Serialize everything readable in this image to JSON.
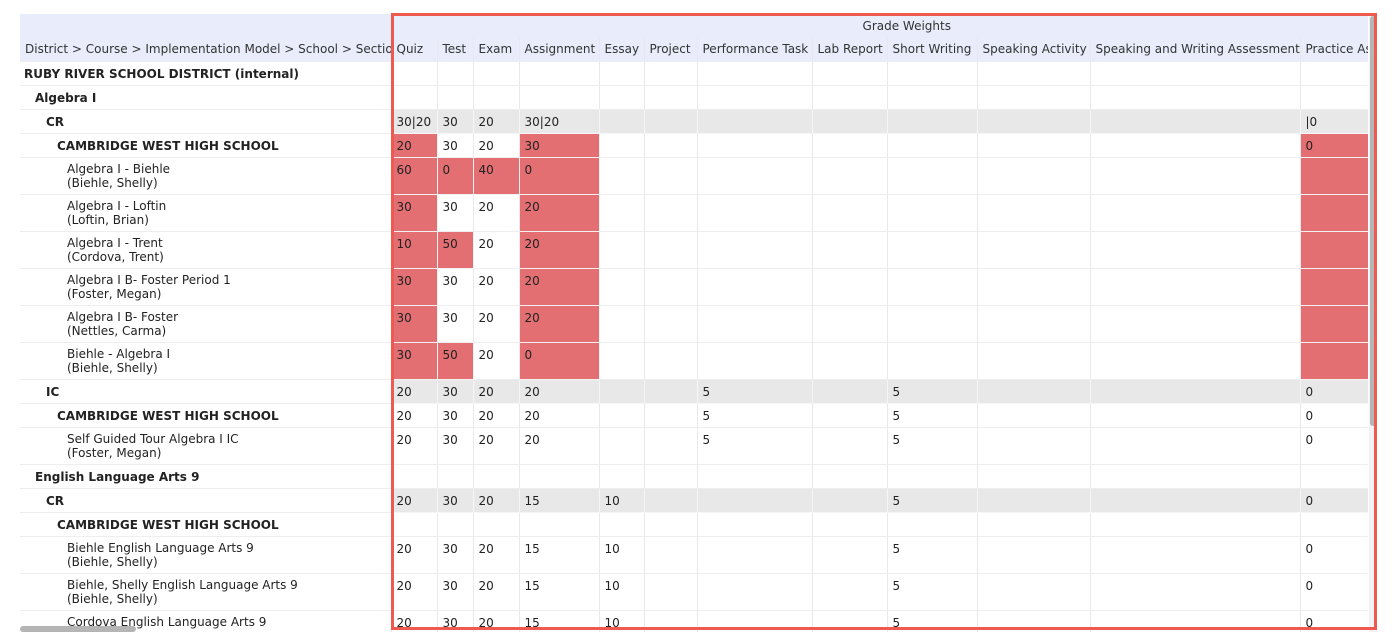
{
  "header": {
    "group_title": "Grade Weights",
    "tree_column": "District > Course > Implementation Model > School > Section",
    "columns": [
      "Quiz",
      "Test",
      "Exam",
      "Assignment",
      "Essay",
      "Project",
      "Performance Task",
      "Lab Report",
      "Short Writing",
      "Speaking Activity",
      "Speaking and Writing Assessment",
      "Practice Assessment"
    ]
  },
  "rows": [
    {
      "label": "RUBY RIVER SCHOOL DISTRICT (internal)",
      "weights": [
        "",
        "",
        "",
        "",
        "",
        "",
        "",
        "",
        "",
        "",
        "",
        ""
      ]
    },
    {
      "label": "Algebra I",
      "weights": [
        "",
        "",
        "",
        "",
        "",
        "",
        "",
        "",
        "",
        "",
        "",
        ""
      ]
    },
    {
      "label": "CR",
      "weights": [
        "30|20",
        "30",
        "20",
        "30|20",
        "",
        "",
        "",
        "",
        "",
        "",
        "",
        "|0"
      ]
    },
    {
      "label": "CAMBRIDGE WEST HIGH SCHOOL",
      "weights": [
        "20",
        "30",
        "20",
        "30",
        "",
        "",
        "",
        "",
        "",
        "",
        "",
        "0"
      ]
    },
    {
      "label": "Algebra I - Biehle",
      "teacher": "(Biehle, Shelly)",
      "weights": [
        "60",
        "0",
        "40",
        "0",
        "",
        "",
        "",
        "",
        "",
        "",
        "",
        ""
      ]
    },
    {
      "label": "Algebra I - Loftin",
      "teacher": "(Loftin, Brian)",
      "weights": [
        "30",
        "30",
        "20",
        "20",
        "",
        "",
        "",
        "",
        "",
        "",
        "",
        ""
      ]
    },
    {
      "label": "Algebra I - Trent",
      "teacher": "(Cordova, Trent)",
      "weights": [
        "10",
        "50",
        "20",
        "20",
        "",
        "",
        "",
        "",
        "",
        "",
        "",
        ""
      ]
    },
    {
      "label": "Algebra I B- Foster Period 1",
      "teacher": "(Foster, Megan)",
      "weights": [
        "30",
        "30",
        "20",
        "20",
        "",
        "",
        "",
        "",
        "",
        "",
        "",
        ""
      ]
    },
    {
      "label": "Algebra I B- Foster",
      "teacher": "(Nettles, Carma)",
      "weights": [
        "30",
        "30",
        "20",
        "20",
        "",
        "",
        "",
        "",
        "",
        "",
        "",
        ""
      ]
    },
    {
      "label": "Biehle - Algebra I",
      "teacher": "(Biehle, Shelly)",
      "weights": [
        "30",
        "50",
        "20",
        "0",
        "",
        "",
        "",
        "",
        "",
        "",
        "",
        ""
      ]
    },
    {
      "label": "IC",
      "weights": [
        "20",
        "30",
        "20",
        "20",
        "",
        "",
        "5",
        "",
        "5",
        "",
        "",
        "0"
      ]
    },
    {
      "label": "CAMBRIDGE WEST HIGH SCHOOL",
      "weights": [
        "20",
        "30",
        "20",
        "20",
        "",
        "",
        "5",
        "",
        "5",
        "",
        "",
        "0"
      ]
    },
    {
      "label": "Self Guided Tour Algebra I IC",
      "teacher": "(Foster, Megan)",
      "weights": [
        "20",
        "30",
        "20",
        "20",
        "",
        "",
        "5",
        "",
        "5",
        "",
        "",
        "0"
      ]
    },
    {
      "label": "English Language Arts 9",
      "weights": [
        "",
        "",
        "",
        "",
        "",
        "",
        "",
        "",
        "",
        "",
        "",
        ""
      ]
    },
    {
      "label": "CR",
      "weights": [
        "20",
        "30",
        "20",
        "15",
        "10",
        "",
        "",
        "",
        "5",
        "",
        "",
        "0"
      ]
    },
    {
      "label": "CAMBRIDGE WEST HIGH SCHOOL",
      "weights": [
        "",
        "",
        "",
        "",
        "",
        "",
        "",
        "",
        "",
        "",
        "",
        ""
      ]
    },
    {
      "label": "Biehle English Language Arts 9",
      "teacher": "(Biehle, Shelly)",
      "weights": [
        "20",
        "30",
        "20",
        "15",
        "10",
        "",
        "",
        "",
        "5",
        "",
        "",
        "0"
      ]
    },
    {
      "label": "Biehle, Shelly English Language Arts 9",
      "teacher": "(Biehle, Shelly)",
      "weights": [
        "20",
        "30",
        "20",
        "15",
        "10",
        "",
        "",
        "",
        "5",
        "",
        "",
        "0"
      ]
    },
    {
      "label": "Cordova English Language Arts 9",
      "teacher": "",
      "weights": [
        "20",
        "30",
        "20",
        "15",
        "10",
        "",
        "",
        "",
        "5",
        "",
        "",
        "0"
      ]
    }
  ],
  "highlight_color": "#e36f73",
  "accent_border_color": "#ef5a50"
}
